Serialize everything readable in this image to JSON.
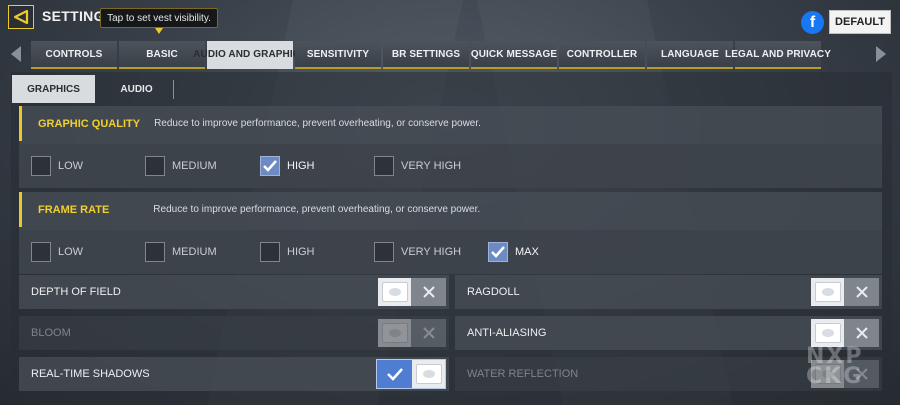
{
  "header": {
    "title": "SETTINGS",
    "tooltip": "Tap to set vest visibility.",
    "facebook_icon": "f",
    "default_label": "DEFAULT"
  },
  "tabs": [
    {
      "label": "CONTROLS",
      "active": false
    },
    {
      "label": "BASIC",
      "active": false
    },
    {
      "label": "AUDIO AND GRAPHICS",
      "active": true
    },
    {
      "label": "SENSITIVITY",
      "active": false
    },
    {
      "label": "BR SETTINGS",
      "active": false
    },
    {
      "label": "QUICK MESSAGE",
      "active": false
    },
    {
      "label": "CONTROLLER",
      "active": false
    },
    {
      "label": "LANGUAGE",
      "active": false
    },
    {
      "label": "LEGAL AND PRIVACY",
      "active": false
    }
  ],
  "subtabs": [
    {
      "label": "GRAPHICS",
      "active": true
    },
    {
      "label": "AUDIO",
      "active": false
    }
  ],
  "graphic_quality": {
    "title": "GRAPHIC QUALITY",
    "description": "Reduce to improve performance, prevent overheating, or conserve power.",
    "options": [
      {
        "label": "LOW",
        "checked": false
      },
      {
        "label": "MEDIUM",
        "checked": false
      },
      {
        "label": "HIGH",
        "checked": true
      },
      {
        "label": "VERY HIGH",
        "checked": false
      }
    ]
  },
  "frame_rate": {
    "title": "FRAME RATE",
    "description": "Reduce to improve performance, prevent overheating, or conserve power.",
    "options": [
      {
        "label": "LOW",
        "checked": false
      },
      {
        "label": "MEDIUM",
        "checked": false
      },
      {
        "label": "HIGH",
        "checked": false
      },
      {
        "label": "VERY HIGH",
        "checked": false
      },
      {
        "label": "MAX",
        "checked": true
      }
    ]
  },
  "toggles": {
    "depth_of_field": {
      "label": "DEPTH OF FIELD",
      "state": "off",
      "enabled": true
    },
    "ragdoll": {
      "label": "RAGDOLL",
      "state": "off",
      "enabled": true
    },
    "bloom": {
      "label": "BLOOM",
      "state": "off",
      "enabled": false
    },
    "anti_aliasing": {
      "label": "ANTI-ALIASING",
      "state": "off",
      "enabled": true
    },
    "real_time_shadows": {
      "label": "REAL-TIME SHADOWS",
      "state": "on",
      "enabled": true
    },
    "water_reflection": {
      "label": "WATER REFLECTION",
      "state": "off",
      "enabled": false
    }
  },
  "watermark": {
    "line1": "NXP",
    "line2": "CKG"
  },
  "colors": {
    "accent": "#e9c92c",
    "check_blue": "#6c8bc2",
    "toggle_on": "#4f7dd1"
  }
}
